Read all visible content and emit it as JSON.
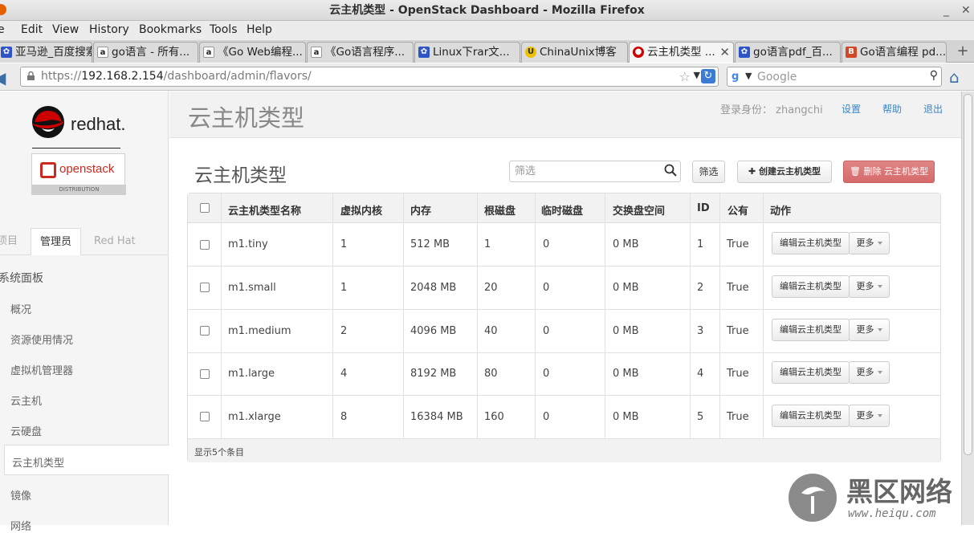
{
  "window": {
    "title": "云主机类型 - OpenStack Dashboard - Mozilla Firefox",
    "minimize": "_",
    "close": "✕"
  },
  "menu": [
    "Edit",
    "View",
    "History",
    "Bookmarks",
    "Tools",
    "Help"
  ],
  "menu_first_partial": "e",
  "tabs": [
    {
      "label": "亚马逊_百度搜索",
      "icon": "baidu-icon"
    },
    {
      "label": "go语言 - 所有...",
      "icon": "amazon-icon"
    },
    {
      "label": "《Go Web编程...",
      "icon": "amazon-icon"
    },
    {
      "label": "《Go语言程序...",
      "icon": "amazon-icon"
    },
    {
      "label": "Linux下rar文...",
      "icon": "baidu-icon"
    },
    {
      "label": "ChinaUnix博客",
      "icon": "chinaunix-icon"
    },
    {
      "label": "云主机类型 ...",
      "icon": "redhat-icon",
      "active": true
    },
    {
      "label": "go语言pdf_百...",
      "icon": "baidu-icon"
    },
    {
      "label": "Go语言编程 pd...",
      "icon": "b-icon"
    }
  ],
  "nav": {
    "url_prefix": "https://",
    "url_host": "192.168.2.154",
    "url_path": "/dashboard/admin/flavors/",
    "search_placeholder": "Google"
  },
  "sidebar": {
    "logo_text": "redhat.",
    "openstack_text": "openstack",
    "distribution_text": "DISTRIBUTION",
    "tabs": [
      "项目",
      "管理员",
      "Red Hat"
    ],
    "active_tab": "管理员",
    "section": "系统面板",
    "items": [
      "概况",
      "资源使用情况",
      "虚拟机管理器",
      "云主机",
      "云硬盘",
      "云主机类型",
      "镜像",
      "网络"
    ],
    "active_item": "云主机类型"
  },
  "header": {
    "title": "云主机类型",
    "login_label": "登录身份：",
    "user": "zhangchi",
    "links": [
      "设置",
      "帮助",
      "退出"
    ]
  },
  "table_header": {
    "title": "云主机类型",
    "filter_placeholder": "筛选",
    "filter_button": "筛选",
    "create_button": "创建云主机类型",
    "delete_button": "删除 云主机类型"
  },
  "table": {
    "columns": [
      "云主机类型名称",
      "虚拟内核",
      "内存",
      "根磁盘",
      "临时磁盘",
      "交换盘空间",
      "ID",
      "公有",
      "动作"
    ],
    "rows": [
      [
        "m1.tiny",
        "1",
        "512 MB",
        "1",
        "0",
        "0 MB",
        "1",
        "True"
      ],
      [
        "m1.small",
        "1",
        "2048 MB",
        "20",
        "0",
        "0 MB",
        "2",
        "True"
      ],
      [
        "m1.medium",
        "2",
        "4096 MB",
        "40",
        "0",
        "0 MB",
        "3",
        "True"
      ],
      [
        "m1.large",
        "4",
        "8192 MB",
        "80",
        "0",
        "0 MB",
        "4",
        "True"
      ],
      [
        "m1.xlarge",
        "8",
        "16384 MB",
        "160",
        "0",
        "0 MB",
        "5",
        "True"
      ]
    ],
    "edit_label": "编辑云主机类型",
    "more_label": "更多",
    "footer": "显示5个条目"
  },
  "watermark": {
    "cn": "黑区网络",
    "url": "www.heiqu.com"
  }
}
